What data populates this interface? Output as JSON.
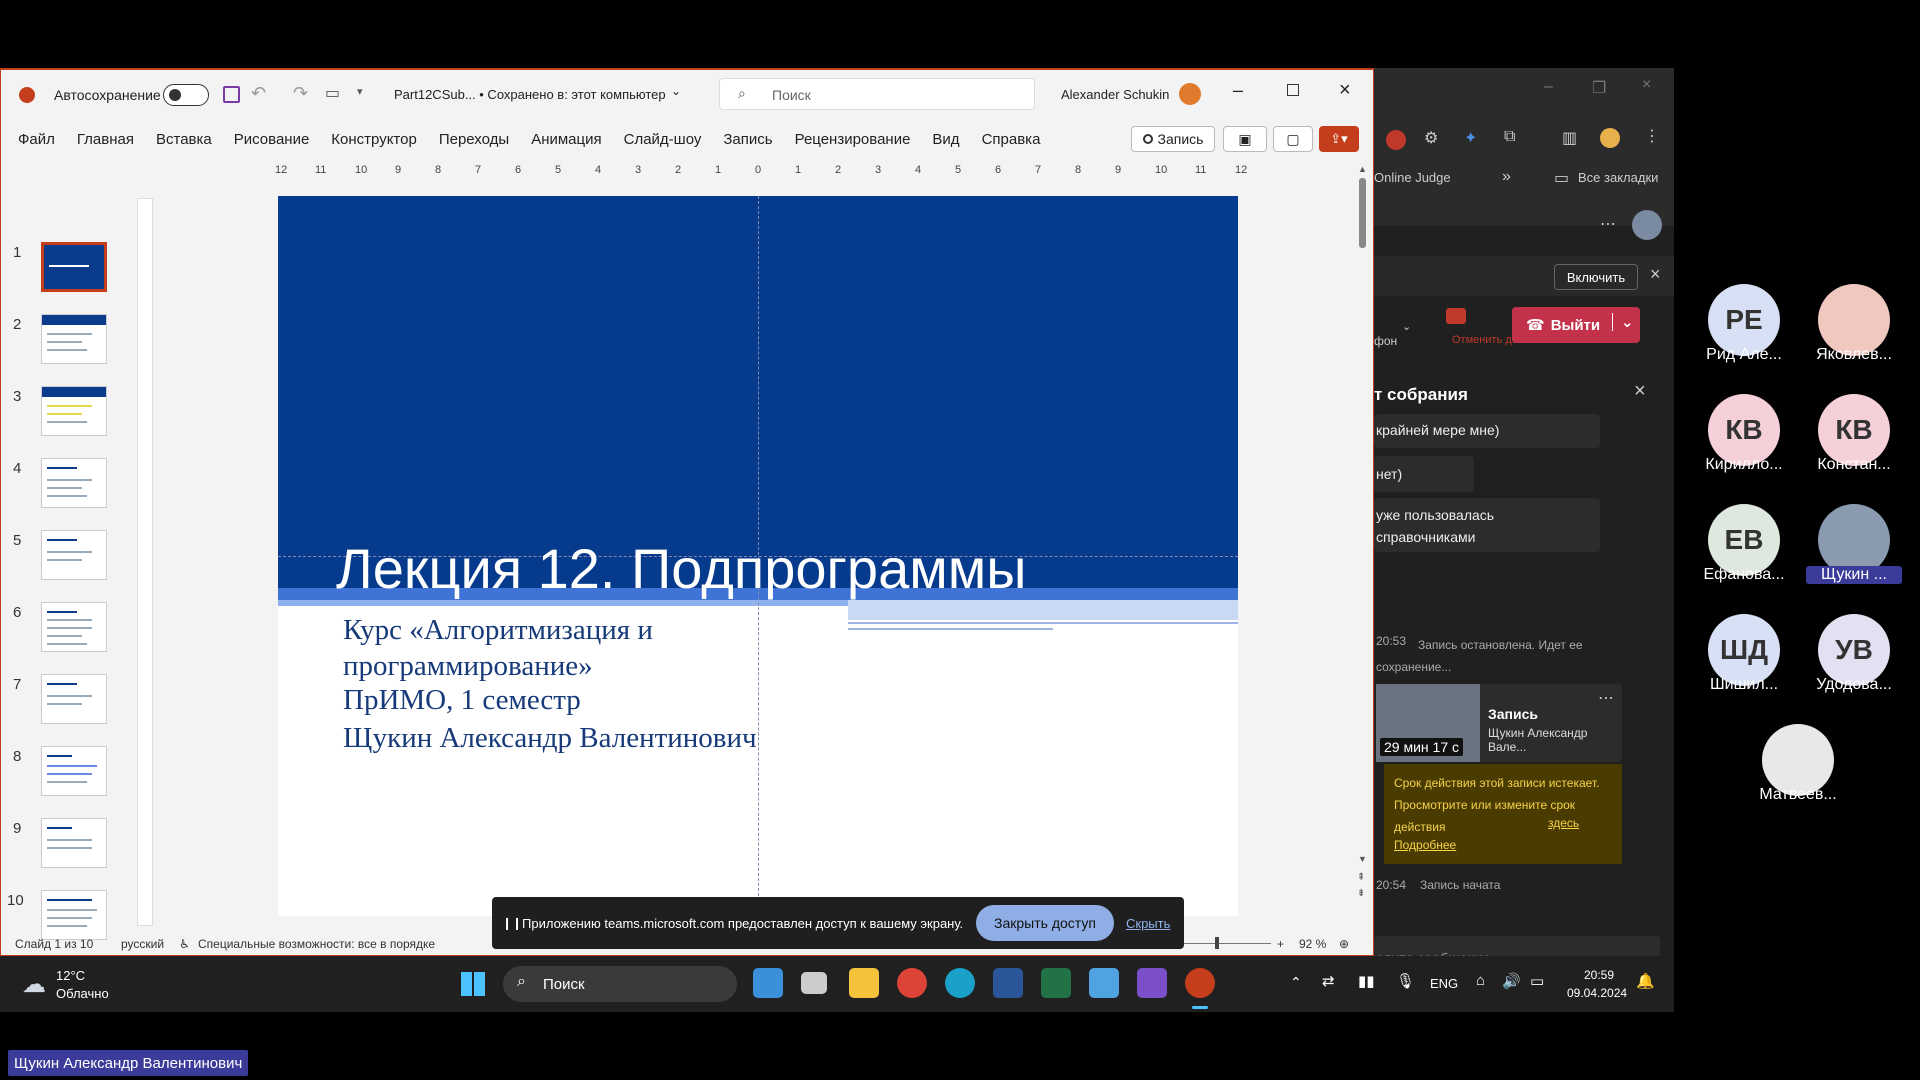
{
  "ppt": {
    "autosave_label": "Автосохранение",
    "doc_title": "Part12CSub... • Сохранено в: этот компьютер",
    "search_placeholder": "Поиск",
    "user_name": "Alexander Schukin",
    "menu": [
      "Файл",
      "Главная",
      "Вставка",
      "Рисование",
      "Конструктор",
      "Переходы",
      "Анимация",
      "Слайд-шоу",
      "Запись",
      "Рецензирование",
      "Вид",
      "Справка"
    ],
    "record_btn": "Запись",
    "ruler_labels": [
      "12",
      "11",
      "10",
      "9",
      "8",
      "7",
      "6",
      "5",
      "4",
      "3",
      "2",
      "1",
      "0",
      "1",
      "2",
      "3",
      "4",
      "5",
      "6",
      "7",
      "8",
      "9",
      "10",
      "11",
      "12"
    ],
    "thumb_numbers": [
      "1",
      "2",
      "3",
      "4",
      "5",
      "6",
      "7",
      "8",
      "9",
      "10"
    ],
    "slide": {
      "title": "Лекция 12. Подпрограммы",
      "line1": "Курс «Алгоритмизация и",
      "line2": "программирование»",
      "line3": "ПрИМО, 1 семестр",
      "line4": "Щукин Александр Валентинович"
    },
    "status": {
      "slide_counter": "Слайд 1 из 10",
      "language": "русский",
      "accessibility": "Специальные возможности: все в порядке",
      "zoom": "92 %"
    }
  },
  "share_banner": {
    "text": "Приложению teams.microsoft.com предоставлен доступ к вашему экрану.",
    "stop_label": "Закрыть доступ",
    "hide_label": "Скрыть"
  },
  "browser": {
    "bookmark_online_judge": "Online Judge",
    "bookmark_all": "Все закладки"
  },
  "teams": {
    "enable_btn": "Включить",
    "mic_label": "фон",
    "cancel_label": "Отменить д...",
    "leave_btn": "Выйти",
    "chat_title": "т собрания",
    "messages": [
      {
        "text": "крайней мере мне)"
      },
      {
        "text": "нет)"
      },
      {
        "text": "уже пользовалась справочниками"
      }
    ],
    "event1_time": "20:53",
    "event1_text": "Запись остановлена. Идет ее сохранение...",
    "recording_card": {
      "title": "Запись",
      "author": "Щукин Александр Вале...",
      "duration": "29 мин 17 с"
    },
    "expiry_text": "Срок действия этой записи истекает. Просмотрите или измените срок действия",
    "expiry_link": "здесь",
    "expiry_more": "Подробнее",
    "event2_time": "20:54",
    "event2_text": "Запись начата",
    "compose_placeholder": "едите сообщение"
  },
  "participants": [
    {
      "initials": "РЕ",
      "name": "Рид Але...",
      "color": "#d8e0f5"
    },
    {
      "initials": "",
      "name": "Яковлев...",
      "color": "#f1c8c0"
    },
    {
      "initials": "КВ",
      "name": "Кирилло...",
      "color": "#f5d0d8"
    },
    {
      "initials": "КВ",
      "name": "Констан...",
      "color": "#f5d0d8"
    },
    {
      "initials": "ЕВ",
      "name": "Ефанова...",
      "color": "#dfe8df"
    },
    {
      "initials": "",
      "name": "Щукин ...",
      "color": "#8a9bb0"
    },
    {
      "initials": "ШД",
      "name": "Шишил...",
      "color": "#d8e0f5"
    },
    {
      "initials": "УВ",
      "name": "Удодова...",
      "color": "#e5dff2"
    },
    {
      "initials": "",
      "name": "Матвеев...",
      "color": "#e8e8e8"
    }
  ],
  "taskbar": {
    "weather_temp": "12°C",
    "weather_desc": "Облачно",
    "search": "Поиск",
    "lang": "ENG",
    "time": "20:59",
    "date": "09.04.2024"
  },
  "presenter_name": "Щукин Александр Валентинович"
}
